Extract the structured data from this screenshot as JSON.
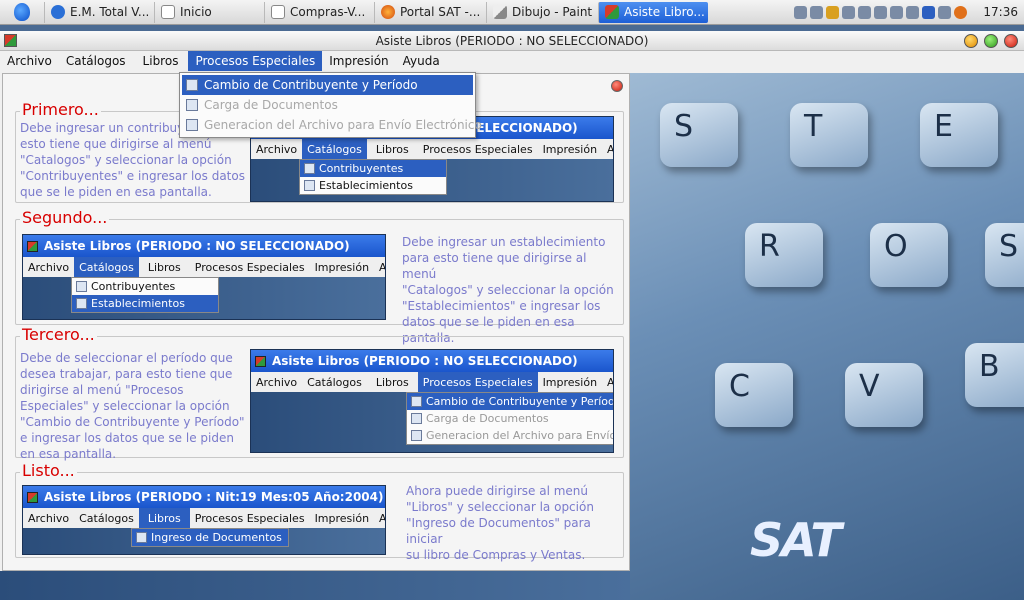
{
  "taskbar": {
    "tasks": [
      {
        "label": "E.M. Total V...",
        "icon": "globe-icon",
        "color": "#2a6fd6"
      },
      {
        "label": "Inicio",
        "icon": "document-icon",
        "color": "#d8d8d8"
      },
      {
        "label": "Compras-V...",
        "icon": "document-icon",
        "color": "#d8d8d8"
      },
      {
        "label": "Portal SAT -...",
        "icon": "firefox-icon",
        "color": "#e06a1a"
      },
      {
        "label": "Dibujo - Paint",
        "icon": "paint-icon",
        "color": "#9a9a9a"
      },
      {
        "label": "Asiste Libro...",
        "icon": "app-icon",
        "color": "#c83a2a"
      }
    ],
    "clock": "17:36"
  },
  "window": {
    "title": "Asiste Libros (PERIODO : NO SELECCIONADO)"
  },
  "menubar": [
    "Archivo",
    "Catálogos",
    "Libros",
    "Procesos Especiales",
    "Impresión",
    "Ayuda"
  ],
  "dropdown": {
    "items": [
      {
        "label": "Cambio de Contribuyente y Período",
        "state": "selected"
      },
      {
        "label": "Carga de Documentos",
        "state": "disabled"
      },
      {
        "label": "Generacion del Archivo para Envío Electrónico",
        "state": "disabled"
      }
    ]
  },
  "steps": [
    {
      "title": "Primero...",
      "text": [
        "Debe ingresar un contribuyente,",
        "esto tiene que dirigirse al menú",
        "\"Catalogos\" y seleccionar la opción",
        "\"Contribuyentes\" e ingresar los datos",
        "que se le piden en esa pantalla."
      ],
      "mini_title": "Asiste Libros (PERIODO : NO SELECCIONADO)",
      "mini_menu": [
        "Archivo",
        "Catálogos",
        "Libros",
        "Procesos Especiales",
        "Impresión",
        "Ayuda"
      ],
      "mini_items": [
        "Contribuyentes",
        "Establecimientos"
      ]
    },
    {
      "title": "Segundo...",
      "text": [
        "Debe ingresar un establecimiento",
        "para esto tiene que dirigirse al menú",
        "\"Catalogos\" y seleccionar la opción",
        "\"Establecimientos\" e ingresar los",
        "datos que se le piden en esa pantalla."
      ],
      "mini_title": "Asiste Libros (PERIODO : NO SELECCIONADO)",
      "mini_menu": [
        "Archivo",
        "Catálogos",
        "Libros",
        "Procesos Especiales",
        "Impresión",
        "Ayuda"
      ],
      "mini_items": [
        "Contribuyentes",
        "Establecimientos"
      ]
    },
    {
      "title": "Tercero...",
      "text": [
        "Debe de seleccionar el período que",
        "desea trabajar, para esto tiene que",
        "dirigirse al menú \"Procesos",
        "Especiales\" y seleccionar la opción",
        "\"Cambio de Contribuyente y Período\"",
        "e ingresar los datos que se le piden",
        "en esa pantalla."
      ],
      "mini_title": "Asiste Libros (PERIODO : NO SELECCIONADO)",
      "mini_menu": [
        "Archivo",
        "Catálogos",
        "Libros",
        "Procesos Especiales",
        "Impresión",
        "Ayuda"
      ],
      "mini_items": [
        "Cambio de Contribuyente y Período",
        "Carga de Documentos",
        "Generacion del Archivo para Envío Elec"
      ]
    },
    {
      "title": "Listo...",
      "text": [
        "Ahora puede dirigirse al menú",
        "\"Libros\" y seleccionar la opción",
        "\"Ingreso de Documentos\" para iniciar",
        "su libro de Compras y Ventas."
      ],
      "mini_title": "Asiste Libros (PERIODO : Nit:19 Mes:05 Año:2004)",
      "mini_menu": [
        "Archivo",
        "Catálogos",
        "Libros",
        "Procesos Especiales",
        "Impresión",
        "Ayuda"
      ],
      "mini_items": [
        "Ingreso de Documentos"
      ]
    }
  ],
  "background": {
    "keys": [
      "S",
      "T",
      "E",
      "R",
      "O",
      "S",
      "C",
      "V",
      "B"
    ],
    "logo_text": "SAT"
  }
}
